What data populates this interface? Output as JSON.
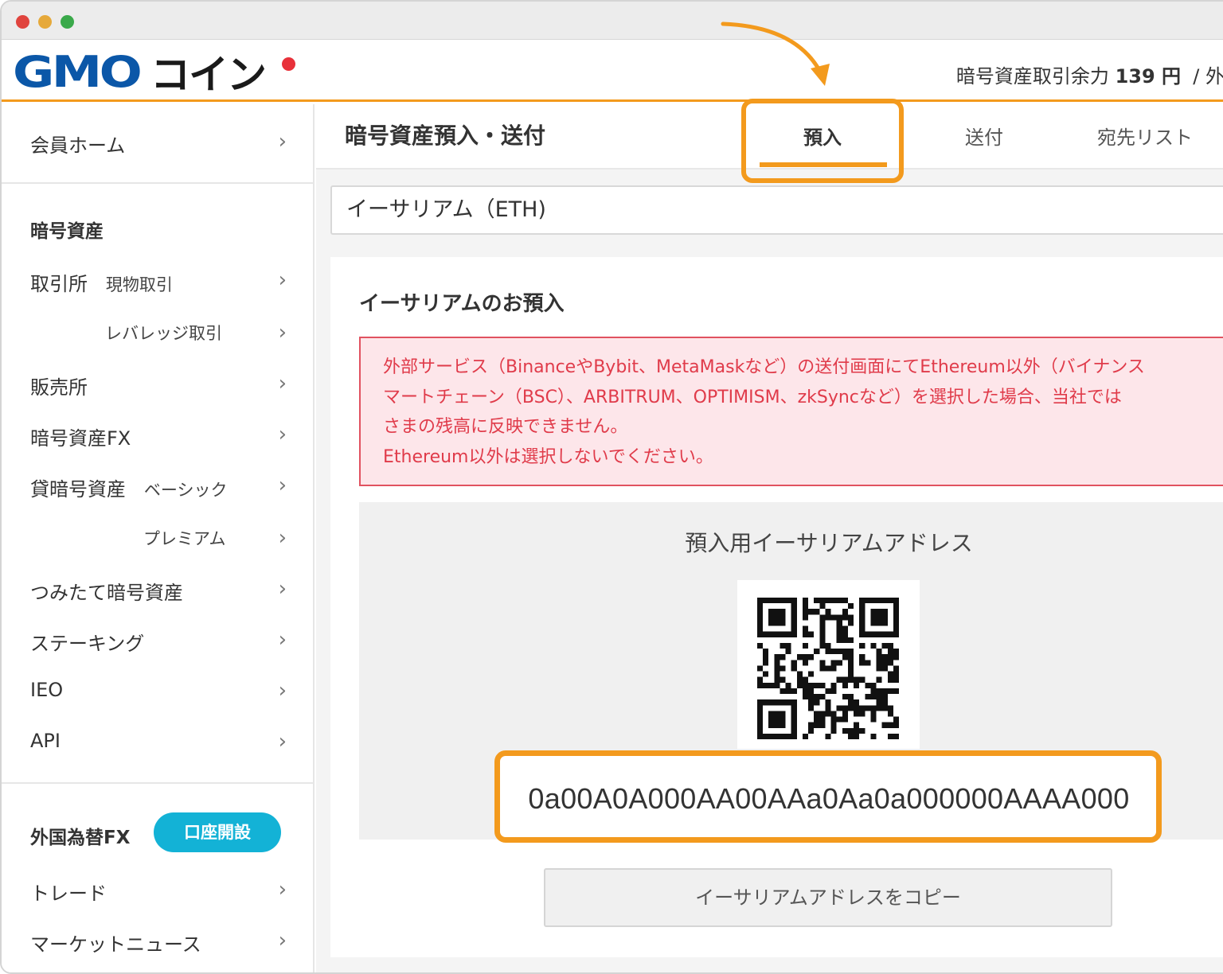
{
  "header": {
    "logo_gmo": "GMO",
    "logo_coin": "コイン",
    "balance_label": "暗号資産取引余力",
    "balance_value": "139 円",
    "balance_tail": "/ 外"
  },
  "sidebar": {
    "home": "会員ホーム",
    "crypto_section": "暗号資産",
    "exchange": "取引所",
    "exchange_spot": "現物取引",
    "exchange_leverage": "レバレッジ取引",
    "sales": "販売所",
    "crypto_fx": "暗号資産FX",
    "lending": "貸暗号資産",
    "lending_basic": "ベーシック",
    "lending_premium": "プレミアム",
    "tsumitate": "つみたて暗号資産",
    "staking": "ステーキング",
    "ieo": "IEO",
    "api": "API",
    "fx_section": "外国為替FX",
    "open_account": "口座開設",
    "trade": "トレード",
    "market_news": "マーケットニュース"
  },
  "main": {
    "page_title": "暗号資産預入・送付",
    "tabs": [
      {
        "label": "預入"
      },
      {
        "label": "送付"
      },
      {
        "label": "宛先リスト"
      }
    ],
    "currency_select": "イーサリアム（ETH)",
    "card_title": "イーサリアムのお預入",
    "alert_lines": [
      "外部サービス（BinanceやBybit、MetaMaskなど）の送付画面にてEthereum以外（バイナンス",
      "マートチェーン（BSC）、ARBITRUM、OPTIMISM、zkSyncなど）を選択した場合、当社では",
      "さまの残高に反映できません。",
      "Ethereum以外は選択しないでください。"
    ],
    "address_label": "預入用イーサリアムアドレス",
    "address_value": "0a00A0A000AA00AAa0Aa0a000000AAAA000",
    "copy_button": "イーサリアムアドレスをコピー"
  },
  "colors": {
    "accent": "#f39a1d",
    "logo_blue": "#0b57a8",
    "button_cyan": "#13b2d6",
    "alert_red": "#e03b4a",
    "alert_bg": "#fde6ea"
  },
  "icons": [
    "chevron-right-icon",
    "qr-code-icon",
    "arrow-icon"
  ]
}
